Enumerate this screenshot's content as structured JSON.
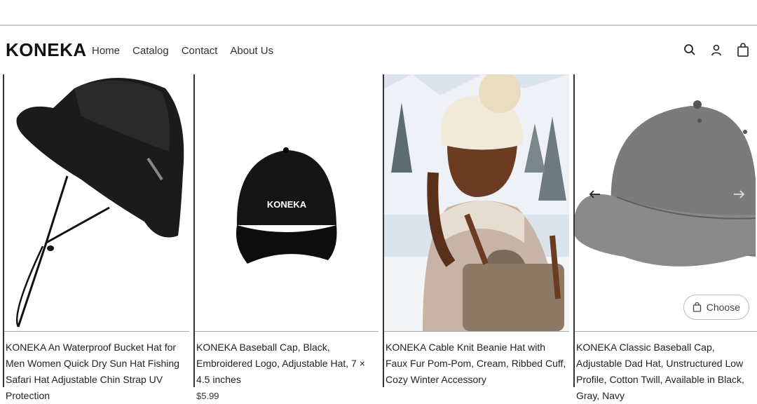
{
  "brand": {
    "name": "KONEKA"
  },
  "nav": {
    "items": [
      {
        "label": "Home"
      },
      {
        "label": "Catalog"
      },
      {
        "label": "Contact"
      },
      {
        "label": "About Us"
      }
    ]
  },
  "header_icons": [
    "search-icon",
    "account-icon",
    "cart-icon"
  ],
  "products": [
    {
      "title": "KONEKA An Waterproof Bucket Hat for Men Women Quick Dry Sun Hat Fishing Safari Hat Adjustable Chin Strap UV Protection",
      "price": ""
    },
    {
      "title": "KONEKA Baseball Cap, Black, Embroidered Logo, Adjustable Hat, 7 × 4.5 inches",
      "price": "$5.99",
      "cap_logo": "KONEKA"
    },
    {
      "title": "KONEKA Cable Knit Beanie Hat with Faux Fur Pom-Pom, Cream, Ribbed Cuff, Cozy Winter Accessory",
      "price": ""
    },
    {
      "title": "KONEKA Classic Baseball Cap, Adjustable Dad Hat, Unstructured Low Profile, Cotton Twill, Available in Black, Gray, Navy",
      "price": "",
      "choose_label": "Choose"
    }
  ],
  "colors": {
    "accent": "#111111",
    "border": "#333333"
  }
}
